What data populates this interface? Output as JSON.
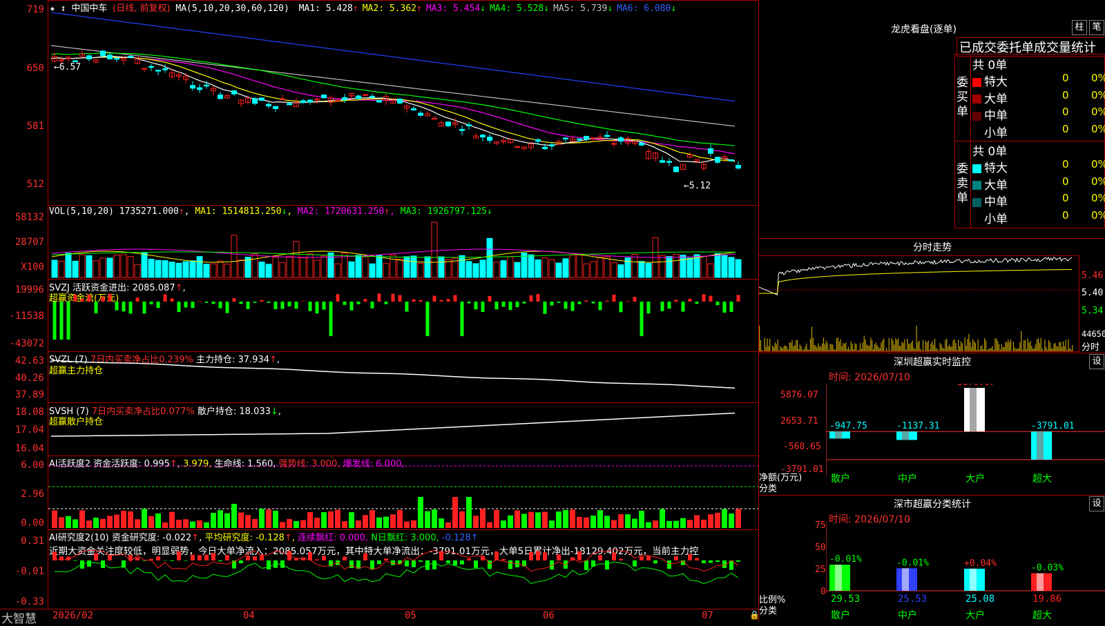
{
  "main": {
    "stock_name": "中国中车",
    "mode": "(日线, 前复权)",
    "ma_label": "MA(5,10,20,30,60,120)",
    "ma": [
      {
        "label": "MA1:",
        "value": "5.428",
        "arrow": "↑",
        "color": "#ffffff"
      },
      {
        "label": "MA2:",
        "value": "5.362",
        "arrow": "↑",
        "color": "#ffff00"
      },
      {
        "label": "MA3:",
        "value": "5.454",
        "arrow": "↓",
        "color": "#ff00ff"
      },
      {
        "label": "MA4:",
        "value": "5.528",
        "arrow": "↓",
        "color": "#00ff00"
      },
      {
        "label": "MA5:",
        "value": "5.739",
        "arrow": "↓",
        "color": "#c0c0c0"
      },
      {
        "label": "MA6:",
        "value": "6.080",
        "arrow": "↓",
        "color": "#3060ff"
      }
    ],
    "y_ticks": [
      "719",
      "650",
      "581",
      "512"
    ],
    "high_label": "←6.57",
    "low_label": "←5.12",
    "star": "★"
  },
  "vol": {
    "header": "VOL(5,10,20)",
    "value": "1735271.000",
    "ma1": "1514813.250",
    "ma2": "1720631.250",
    "ma3": "1926797.125",
    "y_ticks": [
      "58132",
      "28707",
      "X100"
    ]
  },
  "svzj": {
    "header": "SVZJ",
    "label": "活跃资金进出:",
    "value": "2085.087",
    "sub": "超赢资金流(万元)",
    "y_ticks": [
      "19996",
      "-11538",
      "-43072"
    ]
  },
  "svzl": {
    "header": "SVZL (7)",
    "label": "7日内买卖净占比0.239%",
    "main_label": "主力持仓:",
    "main_value": "37.934",
    "sub": "超赢主力持仓",
    "y_ticks": [
      "42.63",
      "40.26",
      "37.89"
    ]
  },
  "svsh": {
    "header": "SVSH (7)",
    "label": "7日内买卖净占比0.077%",
    "retail_label": "散户持仓:",
    "retail_value": "18.033",
    "sub": "超赢散户持仓",
    "y_ticks": [
      "18.08",
      "17.04",
      "16.04"
    ]
  },
  "ai1": {
    "header": "AI活跃度2",
    "label": "资金活跃度:",
    "value": "0.995",
    "value2": "3.979",
    "life_label": "生命线:",
    "life": "1.560",
    "strong_label": "强势线:",
    "strong": "3.000",
    "burst_label": "爆发线:",
    "burst": "6.000",
    "y_ticks": [
      "6.00",
      "2.96",
      "0.00"
    ]
  },
  "ai2": {
    "header": "AI研究度2(10)",
    "label": "资金研究度:",
    "value": "-0.022",
    "avg_label": "平均研究度:",
    "avg": "-0.128",
    "red_label": "连续飘红:",
    "red": "0.000",
    "n_label": "N日飘红:",
    "n": "3.000",
    "n2": "-0.128",
    "text": "近期大资金关注度较低，明显弱势，今日大单净流入：2085.057万元，其中特大单净流出：-3791.01万元，大单5日累计净出-18129.402万元，当前主力控",
    "y_ticks": [
      "0.31",
      "-0.01",
      "-0.33"
    ]
  },
  "xaxis": {
    "brand": "大智慧",
    "labels": [
      "2026/02",
      "04",
      "05",
      "06",
      "07"
    ]
  },
  "lhb": {
    "title": "龙虎看盘(逐单)",
    "btn1": "柱",
    "btn2": "笔",
    "sub_title": "已成交委托单成交量统计",
    "buy_label": "委买单",
    "sell_label": "委卖单",
    "buy_total": "共 0单",
    "sell_total": "共 0单",
    "buy_rows": [
      {
        "name": "特大",
        "color": "#ff0000",
        "count": "0",
        "pct": "0%"
      },
      {
        "name": "大单",
        "color": "#a00000",
        "count": "0",
        "pct": "0%"
      },
      {
        "name": "中单",
        "color": "#600000",
        "count": "0",
        "pct": "0%"
      },
      {
        "name": "小单",
        "color": "#000000",
        "count": "0",
        "pct": "0%"
      }
    ],
    "sell_rows": [
      {
        "name": "特大",
        "color": "#00ffff",
        "count": "0",
        "pct": "0%"
      },
      {
        "name": "大单",
        "color": "#008080",
        "count": "0",
        "pct": "0%"
      },
      {
        "name": "中单",
        "color": "#006060",
        "count": "0",
        "pct": "0%"
      },
      {
        "name": "小单",
        "color": "#000000",
        "count": "0",
        "pct": "0%"
      }
    ]
  },
  "intraday": {
    "title": "分时走势",
    "y_ticks": [
      "5.46",
      "5.40",
      "5.34"
    ],
    "vol_label": "44650",
    "vol_unit": "分时"
  },
  "monitor": {
    "title": "深圳超赢实时监控",
    "btn": "设",
    "time": "时间: 2026/07/10",
    "y_ticks": [
      "5876.07",
      "2653.71",
      "-568.65",
      "-3791.01"
    ],
    "y_label": "净额(万元)",
    "x_label": "分类",
    "categories": [
      "散户",
      "中户",
      "大户",
      "超大"
    ]
  },
  "classify": {
    "title": "深市超赢分类统计",
    "btn": "设",
    "time": "时间: 2026/07/10",
    "y_ticks": [
      "75",
      "50",
      "25",
      "0"
    ],
    "y_label": "比例%",
    "x_label": "分类",
    "categories": [
      "散户",
      "中户",
      "大户",
      "超大"
    ]
  },
  "chart_data": [
    {
      "type": "bar",
      "title": "深圳超赢实时监控",
      "ylabel": "净额(万元)",
      "categories": [
        "散户",
        "中户",
        "大户",
        "超大"
      ],
      "values": [
        -947.75,
        -1137.31,
        5876.07,
        -3791.01
      ],
      "value_labels": [
        "-947.75",
        "-1137.31",
        "5876.07",
        "-3791.01"
      ],
      "ylim": [
        -3791.01,
        5876.07
      ],
      "colors": [
        "#00ffff",
        "#00ffff",
        "#ffffff",
        "#00ffff"
      ]
    },
    {
      "type": "bar",
      "title": "深市超赢分类统计",
      "ylabel": "比例%",
      "categories": [
        "散户",
        "中户",
        "大户",
        "超大"
      ],
      "values": [
        29.53,
        25.53,
        25.08,
        19.86
      ],
      "changes": [
        "-0.01%",
        "-0.01%",
        "+0.04%",
        "-0.03%"
      ],
      "value_labels": [
        "29.53",
        "25.53",
        "25.08",
        "19.86"
      ],
      "ylim": [
        0,
        75
      ],
      "colors": [
        "#00ff00",
        "#3040ff",
        "#00ffff",
        "#ff2020"
      ]
    }
  ]
}
